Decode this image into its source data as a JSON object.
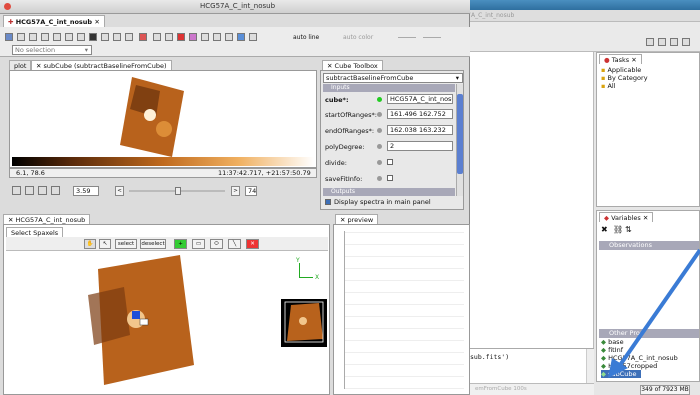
{
  "window": {
    "title": "HCG57A_C_int_nosub",
    "tab": "HCG57A_C_int_nosub"
  },
  "bg_window": {
    "title": "HCG57A_C_int_nosub"
  },
  "toolbar": {
    "auto_line": "auto line",
    "auto_color": "auto color",
    "selection": "No selection"
  },
  "plot_tabs": {
    "plot": "plot",
    "subcube": "subCube (subtractBaselineFromCube)"
  },
  "image_viewer": {
    "range": "6.1, 78.6",
    "coords": "11:37:42.717, +21:57:50.79",
    "zoom": "3.59",
    "slice": "74"
  },
  "toolbox": {
    "tab": "Cube Toolbox",
    "selected": "subtractBaselineFromCube",
    "inputs": "Inputs",
    "outputs": "Outputs",
    "fields": [
      {
        "label": "cube*:",
        "value": "HCG57A_C_int_nosub"
      },
      {
        "label": "startOfRanges*:",
        "value": "161.496 162.752"
      },
      {
        "label": "endOfRanges*:",
        "value": "162.038 163.232"
      },
      {
        "label": "polyDegree:",
        "value": "2"
      },
      {
        "label": "divide:",
        "value": ""
      },
      {
        "label": "saveFitInfo:",
        "value": ""
      }
    ],
    "display_spectra": "Display spectra in main panel"
  },
  "lower_left": {
    "tab": "HCG57A_C_int_nosub",
    "sub_tab": "Select Spaxels",
    "select": "select",
    "deselect": "deselect"
  },
  "preview": {
    "tab": "preview"
  },
  "console": {
    "text": "sub.fits')",
    "status": "emFromCube 100s"
  },
  "tasks": {
    "tab": "Tasks",
    "items": [
      "Applicable",
      "By Category",
      "All"
    ]
  },
  "variables": {
    "tab": "Variables",
    "observations": "Observations",
    "other": "Other Prod",
    "items": [
      "base",
      "fitInf",
      "HCG57A_C_int_nosub",
      "HCG57cropped",
      "subCube"
    ]
  },
  "memory": {
    "text": "349 of 7923 MB"
  },
  "colors": {
    "accent": "#3a7bd5",
    "selected": "#3d6fb8",
    "header": "#a8a8b8"
  }
}
